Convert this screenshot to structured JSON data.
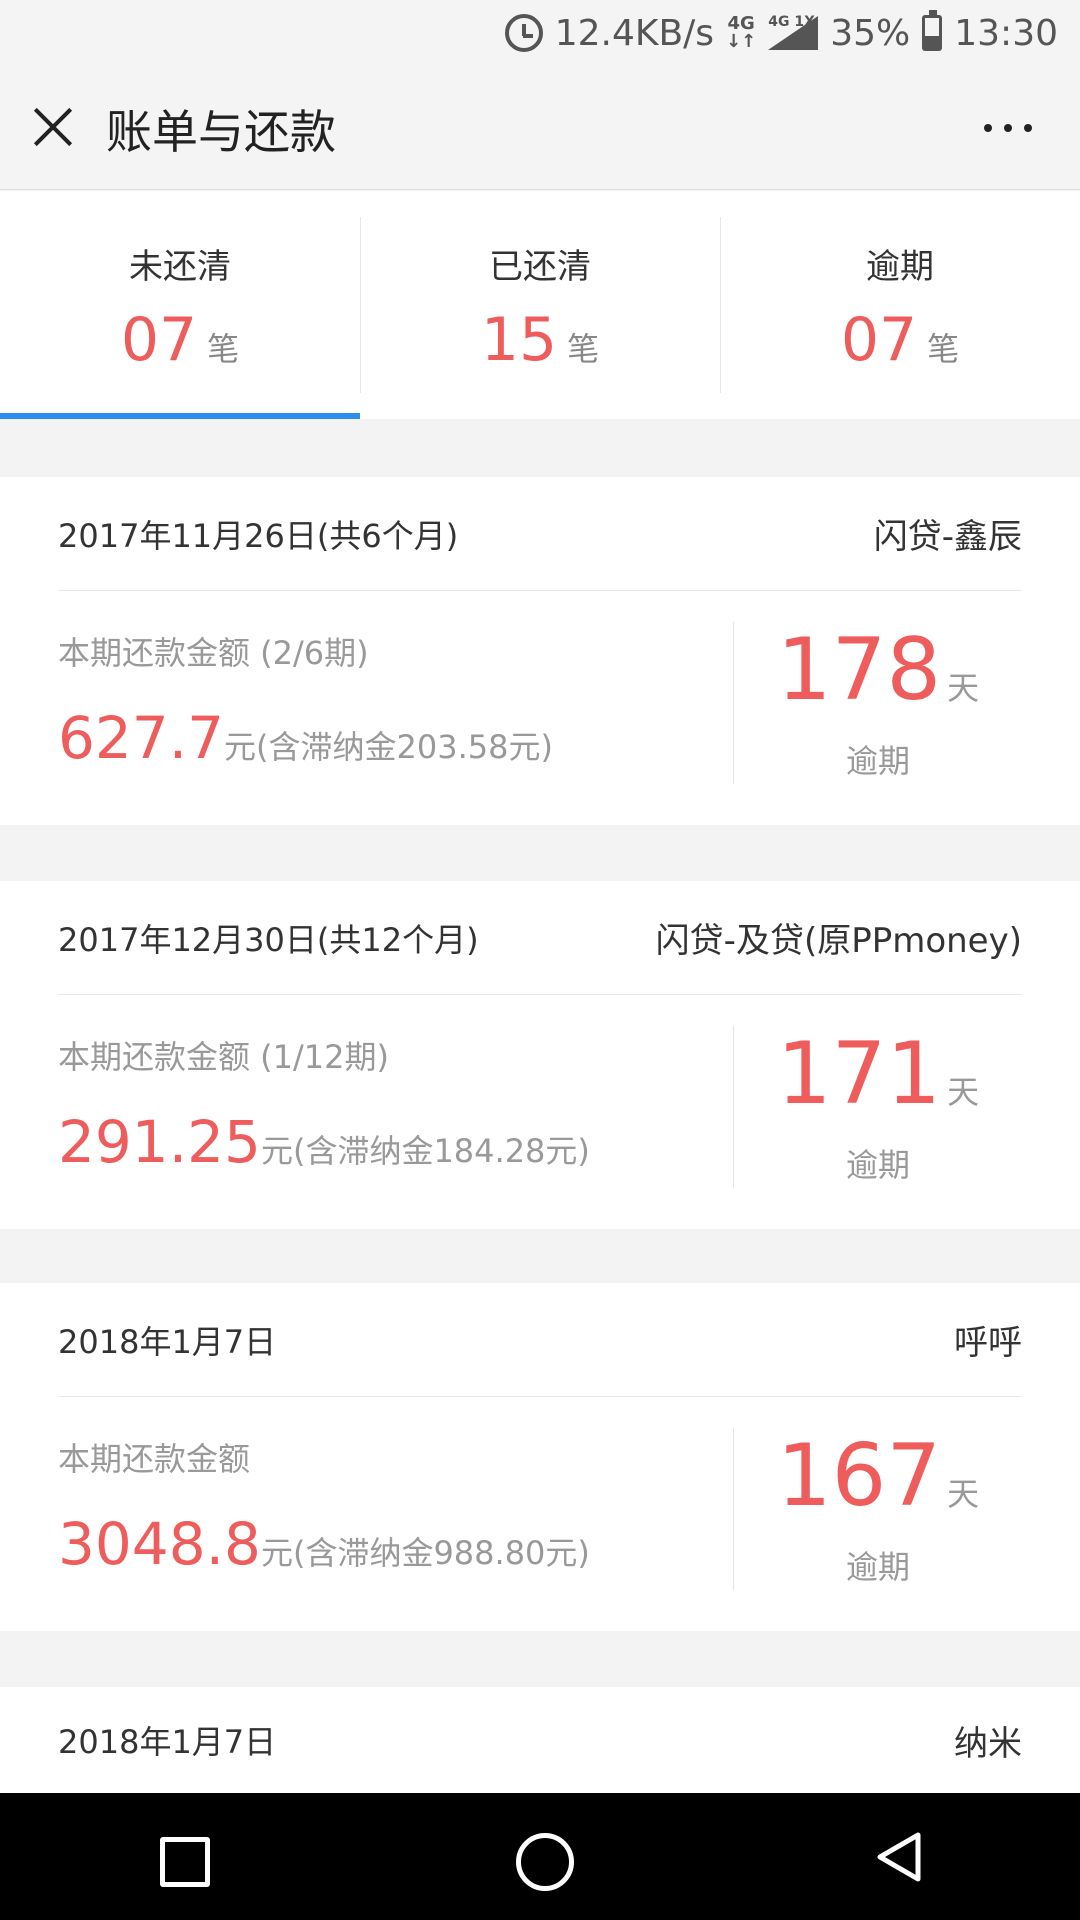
{
  "status_bar": {
    "speed": "12.4KB/s",
    "net_top": "4G",
    "net_bottom": "↓↑",
    "signal_label": "4G 1X",
    "battery": "35%",
    "time": "13:30"
  },
  "header": {
    "title": "账单与还款"
  },
  "tabs": [
    {
      "label": "未还清",
      "count": "07",
      "unit": "笔"
    },
    {
      "label": "已还清",
      "count": "15",
      "unit": "笔"
    },
    {
      "label": "逾期",
      "count": "07",
      "unit": "笔"
    }
  ],
  "bills": [
    {
      "date": "2017年11月26日(共6个月)",
      "lender": "闪贷-鑫辰",
      "amount_label": "本期还款金额 (2/6期)",
      "amount": "627.7",
      "amount_note": "元(含滞纳金203.58元)",
      "overdue_days": "178",
      "overdue_unit": "天",
      "overdue_label": "逾期"
    },
    {
      "date": "2017年12月30日(共12个月)",
      "lender": "闪贷-及贷(原PPmoney)",
      "amount_label": "本期还款金额 (1/12期)",
      "amount": "291.25",
      "amount_note": "元(含滞纳金184.28元)",
      "overdue_days": "171",
      "overdue_unit": "天",
      "overdue_label": "逾期"
    },
    {
      "date": "2018年1月7日",
      "lender": "呼呼",
      "amount_label": "本期还款金额",
      "amount": "3048.8",
      "amount_note": "元(含滞纳金988.80元)",
      "overdue_days": "167",
      "overdue_unit": "天",
      "overdue_label": "逾期"
    },
    {
      "date": "2018年1月7日",
      "lender": "纳米"
    }
  ],
  "colors": {
    "accent_red": "#ee5c5c",
    "tab_indicator": "#2d8ef0"
  }
}
